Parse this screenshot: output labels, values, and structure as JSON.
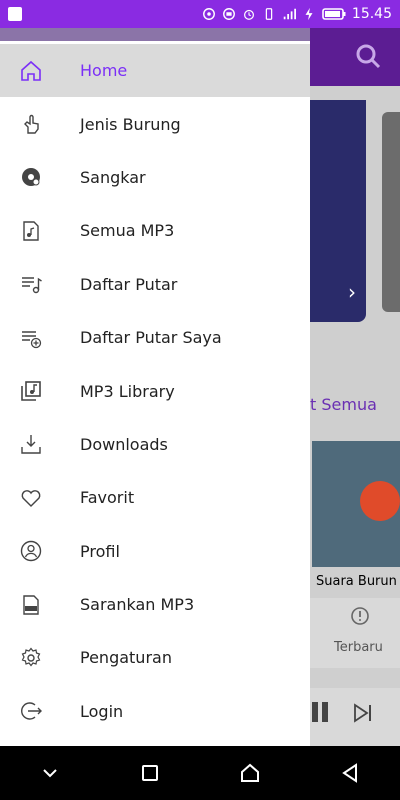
{
  "status_bar": {
    "time": "15.45",
    "icons": [
      "hotspot-icon",
      "data-saver-icon",
      "alarm-icon",
      "vibrate-icon",
      "signal-4g-icon",
      "charging-icon",
      "battery-icon"
    ]
  },
  "background_app": {
    "see_all": "t Semua",
    "track_title": "Suara Burun",
    "bottom_tab_label": "Terbaru"
  },
  "drawer": {
    "active_color": "#7b2ff7",
    "items": [
      {
        "label": "Home",
        "icon": "home-icon",
        "active": true
      },
      {
        "label": "Jenis Burung",
        "icon": "hand-pointer-icon"
      },
      {
        "label": "Sangkar",
        "icon": "disc-music-icon"
      },
      {
        "label": "Semua MP3",
        "icon": "music-file-icon"
      },
      {
        "label": "Daftar Putar",
        "icon": "playlist-icon"
      },
      {
        "label": "Daftar Putar Saya",
        "icon": "playlist-add-icon"
      },
      {
        "label": "MP3 Library",
        "icon": "music-library-icon"
      },
      {
        "label": "Downloads",
        "icon": "download-icon"
      },
      {
        "label": "Favorit",
        "icon": "heart-icon"
      },
      {
        "label": "Profil",
        "icon": "user-circle-icon"
      },
      {
        "label": "Sarankan MP3",
        "icon": "mp3-file-icon"
      },
      {
        "label": "Pengaturan",
        "icon": "gear-icon"
      },
      {
        "label": "Login",
        "icon": "login-icon"
      }
    ]
  },
  "nav_bar": {
    "buttons": [
      "collapse-icon",
      "recent-apps-icon",
      "home-button-icon",
      "back-icon"
    ]
  }
}
